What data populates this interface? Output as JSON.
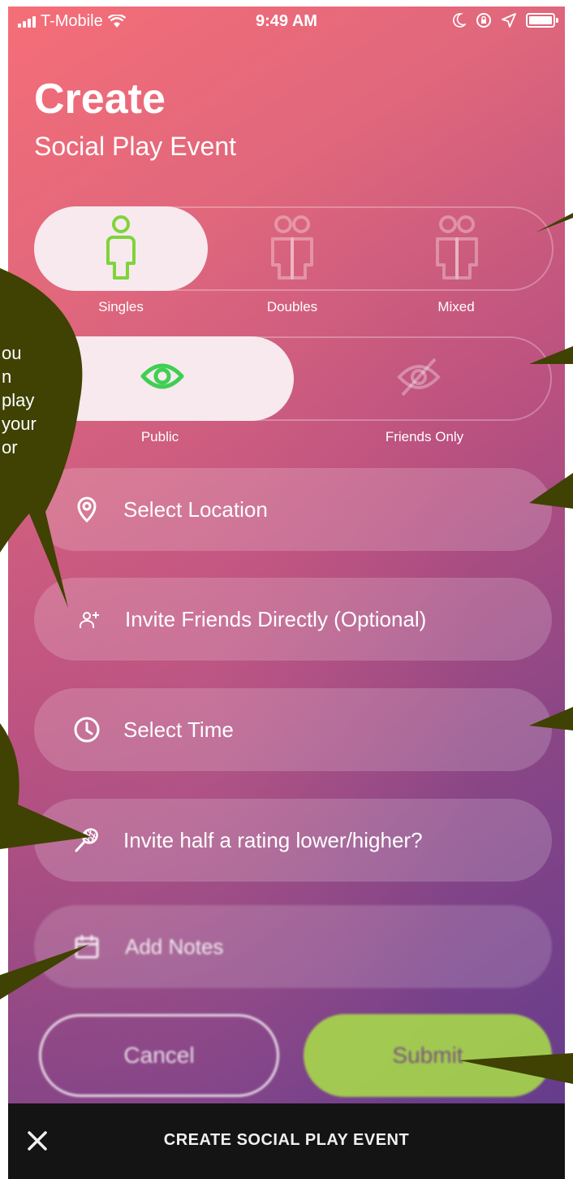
{
  "status_bar": {
    "carrier": "T-Mobile",
    "time": "9:49 AM"
  },
  "header": {
    "title": "Create",
    "subtitle": "Social Play Event"
  },
  "match_type": {
    "options": [
      {
        "label": "Singles",
        "icon": "single-person-icon",
        "selected": true
      },
      {
        "label": "Doubles",
        "icon": "two-people-icon",
        "selected": false
      },
      {
        "label": "Mixed",
        "icon": "two-people-icon",
        "selected": false
      }
    ]
  },
  "visibility": {
    "options": [
      {
        "label": "Public",
        "icon": "eye-icon",
        "selected": true
      },
      {
        "label": "Friends Only",
        "icon": "eye-slash-icon",
        "selected": false
      }
    ]
  },
  "fields": {
    "location": {
      "label": "Select Location",
      "icon": "location-pin-icon"
    },
    "invite_friends": {
      "label": "Invite Friends Directly (Optional)",
      "icon": "add-person-icon"
    },
    "time": {
      "label": "Select Time",
      "icon": "clock-icon"
    },
    "rating": {
      "label": "Invite half a rating lower/higher?",
      "icon": "tennis-racket-icon"
    },
    "notes": {
      "label": "Add Notes",
      "icon": "calendar-icon"
    }
  },
  "buttons": {
    "cancel": "Cancel",
    "submit": "Submit"
  },
  "bottom_bar": {
    "title": "CREATE SOCIAL PLAY EVENT",
    "close_icon": "close-icon"
  },
  "annotation": {
    "bubble_lines": [
      "ou",
      "n",
      "play",
      "your",
      "or"
    ]
  },
  "colors": {
    "gradient_start": "#f56e78",
    "gradient_end": "#5e3a8e",
    "accent_green": "#a8dc4a",
    "icon_green": "#7fd43a",
    "callout": "#3f4202",
    "bottom_bar": "#141414"
  }
}
